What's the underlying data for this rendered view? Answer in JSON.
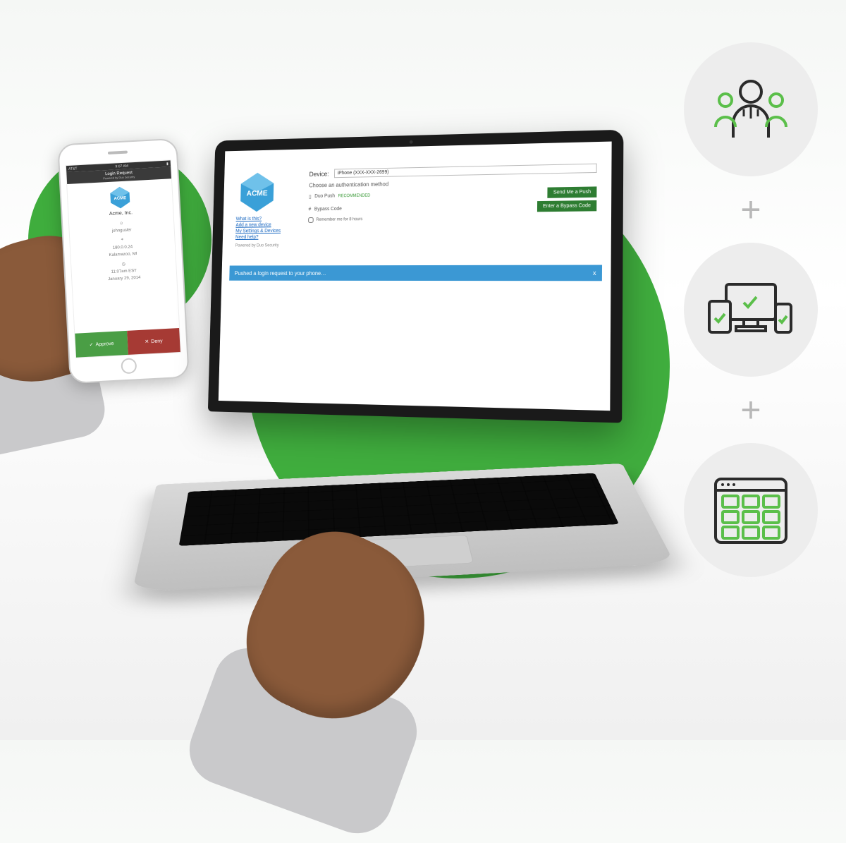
{
  "phone": {
    "status": {
      "carrier": "AT&T",
      "time": "9:07 AM"
    },
    "header": {
      "title": "Login Request",
      "subtitle": "Powered by Duo Security"
    },
    "company": "Acme, Inc.",
    "user": "johngusler",
    "ip": "180.0.0.24",
    "location": "Kalamazoo, MI",
    "time_detail": "11:07am EST",
    "date": "January 29, 2014",
    "approve": "Approve",
    "deny": "Deny"
  },
  "laptop": {
    "device_label": "Device:",
    "device_value": "iPhone (XXX-XXX-2699)",
    "choose": "Choose an authentication method",
    "links": {
      "what": "What is this?",
      "add": "Add a new device",
      "settings": "My Settings & Devices",
      "help": "Need help?"
    },
    "powered": "Powered by Duo Security",
    "options": {
      "push": "Duo Push",
      "recommended": "RECOMMENDED",
      "bypass": "Bypass Code"
    },
    "buttons": {
      "send_push": "Send Me a Push",
      "enter_bypass": "Enter a Bypass Code"
    },
    "remember": "Remember me for 8 hours",
    "banner": "Pushed a login request to your phone…",
    "banner_close": "x"
  }
}
